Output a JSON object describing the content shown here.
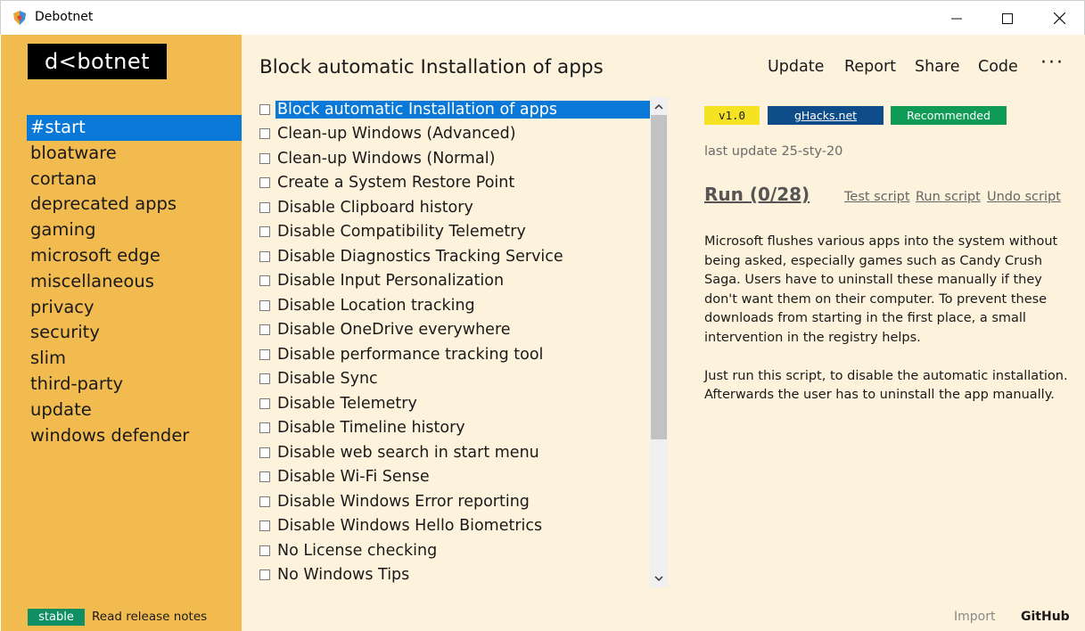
{
  "window": {
    "title": "Debotnet"
  },
  "sidebar": {
    "logo": "d<botnet",
    "categories": [
      "#start",
      "bloatware",
      "cortana",
      "deprecated apps",
      "gaming",
      "microsoft edge",
      "miscellaneous",
      "privacy",
      "security",
      "slim",
      "third-party",
      "update",
      "windows defender"
    ],
    "active_category": "#start",
    "channel_badge": "stable",
    "release_notes": "Read release notes"
  },
  "main": {
    "page_title": "Block automatic Installation of apps",
    "nav": [
      "Update",
      "Report",
      "Share",
      "Code"
    ],
    "scripts": [
      "Block automatic Installation of apps",
      "Clean-up Windows (Advanced)",
      "Clean-up Windows (Normal)",
      "Create a System Restore Point",
      "Disable Clipboard history",
      "Disable Compatibility Telemetry",
      "Disable Diagnostics Tracking Service",
      "Disable Input Personalization",
      "Disable Location tracking",
      "Disable OneDrive everywhere",
      "Disable performance tracking tool",
      "Disable Sync",
      "Disable Telemetry",
      "Disable Timeline history",
      "Disable web search in start menu",
      "Disable Wi-Fi Sense",
      "Disable Windows Error reporting",
      "Disable Windows Hello Biometrics",
      "No License checking",
      "No Windows Tips"
    ],
    "selected_script_index": 0
  },
  "details": {
    "version_badge": "v1.0",
    "source_badge": "gHacks.net",
    "recommended_badge": "Recommended",
    "last_update": "last update 25-sty-20",
    "run_label": "Run (0/28)",
    "test_script": "Test script",
    "run_script": "Run script",
    "undo_script": "Undo script",
    "description_p1": "Microsoft flushes various apps into the system without being asked, especially games such as Candy Crush Saga. Users have to uninstall these manually if they don't want them on their computer. To prevent these downloads from starting in the first place, a small intervention in the registry helps.",
    "description_p2": "Just run this script, to disable the automatic installation. Afterwards the user has to uninstall the app manually."
  },
  "footer": {
    "import": "Import",
    "github": "GitHub"
  },
  "colors": {
    "sidebar_bg": "#f2bb4f",
    "main_bg": "#fdf2dc",
    "selection": "#0a78d7",
    "stable_badge": "#0f8f63",
    "version_badge": "#f5e323",
    "source_badge": "#0f4c8a",
    "recommended_badge": "#0f9a55"
  }
}
